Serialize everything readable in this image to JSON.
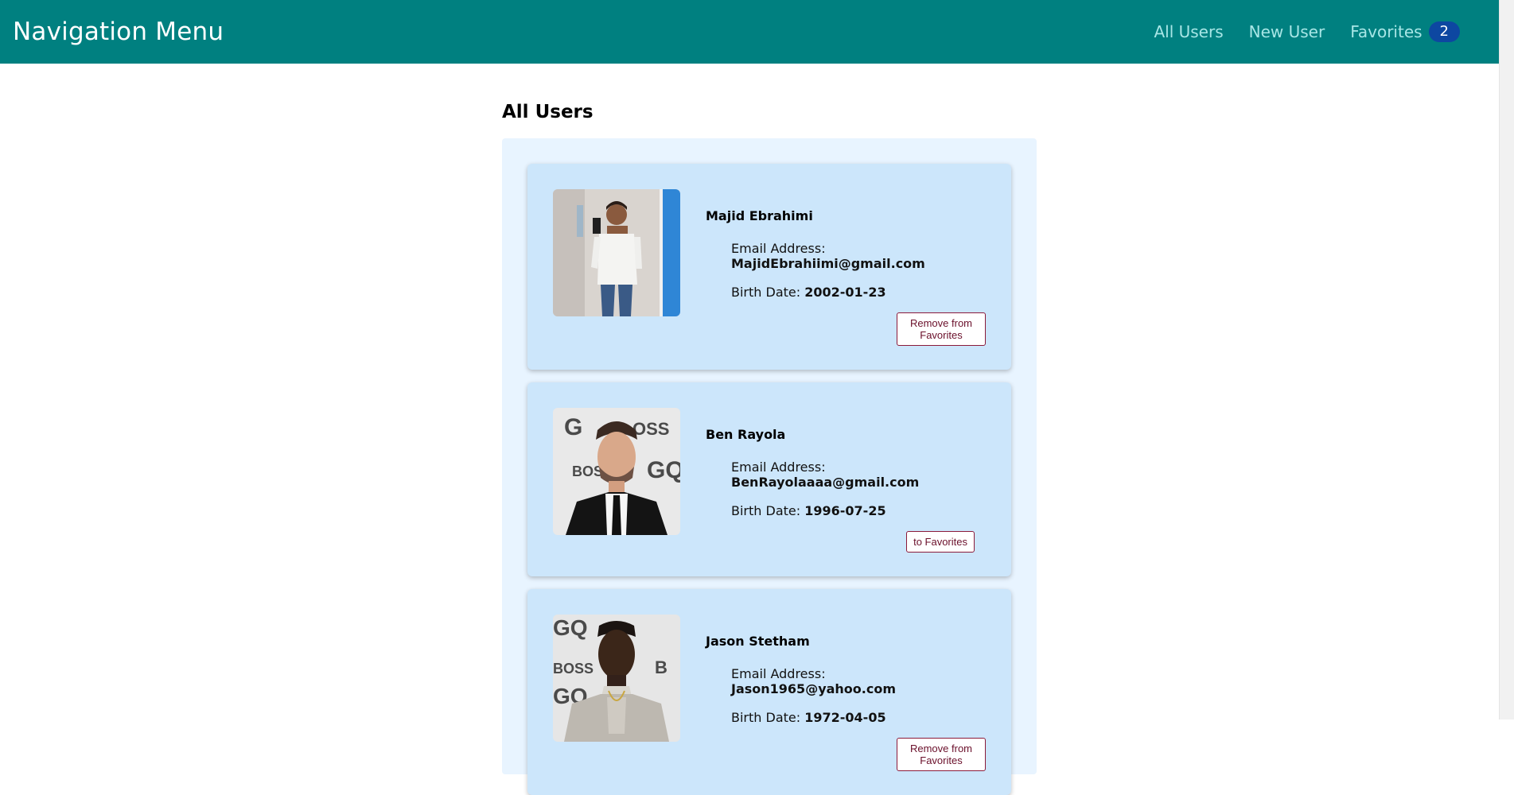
{
  "nav": {
    "brand": "Navigation Menu",
    "links": [
      {
        "label": "All Users"
      },
      {
        "label": "New User"
      },
      {
        "label": "Favorites",
        "badge": "2"
      }
    ]
  },
  "main": {
    "title": "All Users",
    "email_label": "Email Address:",
    "birth_label": "Birth Date:",
    "users": [
      {
        "name": "Majid Ebrahimi",
        "email": "MajidEbrahiimi@gmail.com",
        "birth_date": "2002-01-23",
        "button": "Remove from Favorites"
      },
      {
        "name": "Ben Rayola",
        "email": "BenRayolaaaa@gmail.com",
        "birth_date": "1996-07-25",
        "button": "to Favorites"
      },
      {
        "name": "Jason Stetham",
        "email": "Jason1965@yahoo.com",
        "birth_date": "1972-04-05",
        "button": "Remove from Favorites"
      }
    ]
  },
  "colors": {
    "navbar": "#008080",
    "badge": "#0d47a1",
    "panel": "#e8f4ff",
    "card": "#cce6fb",
    "button_border": "#8b1a3a"
  }
}
